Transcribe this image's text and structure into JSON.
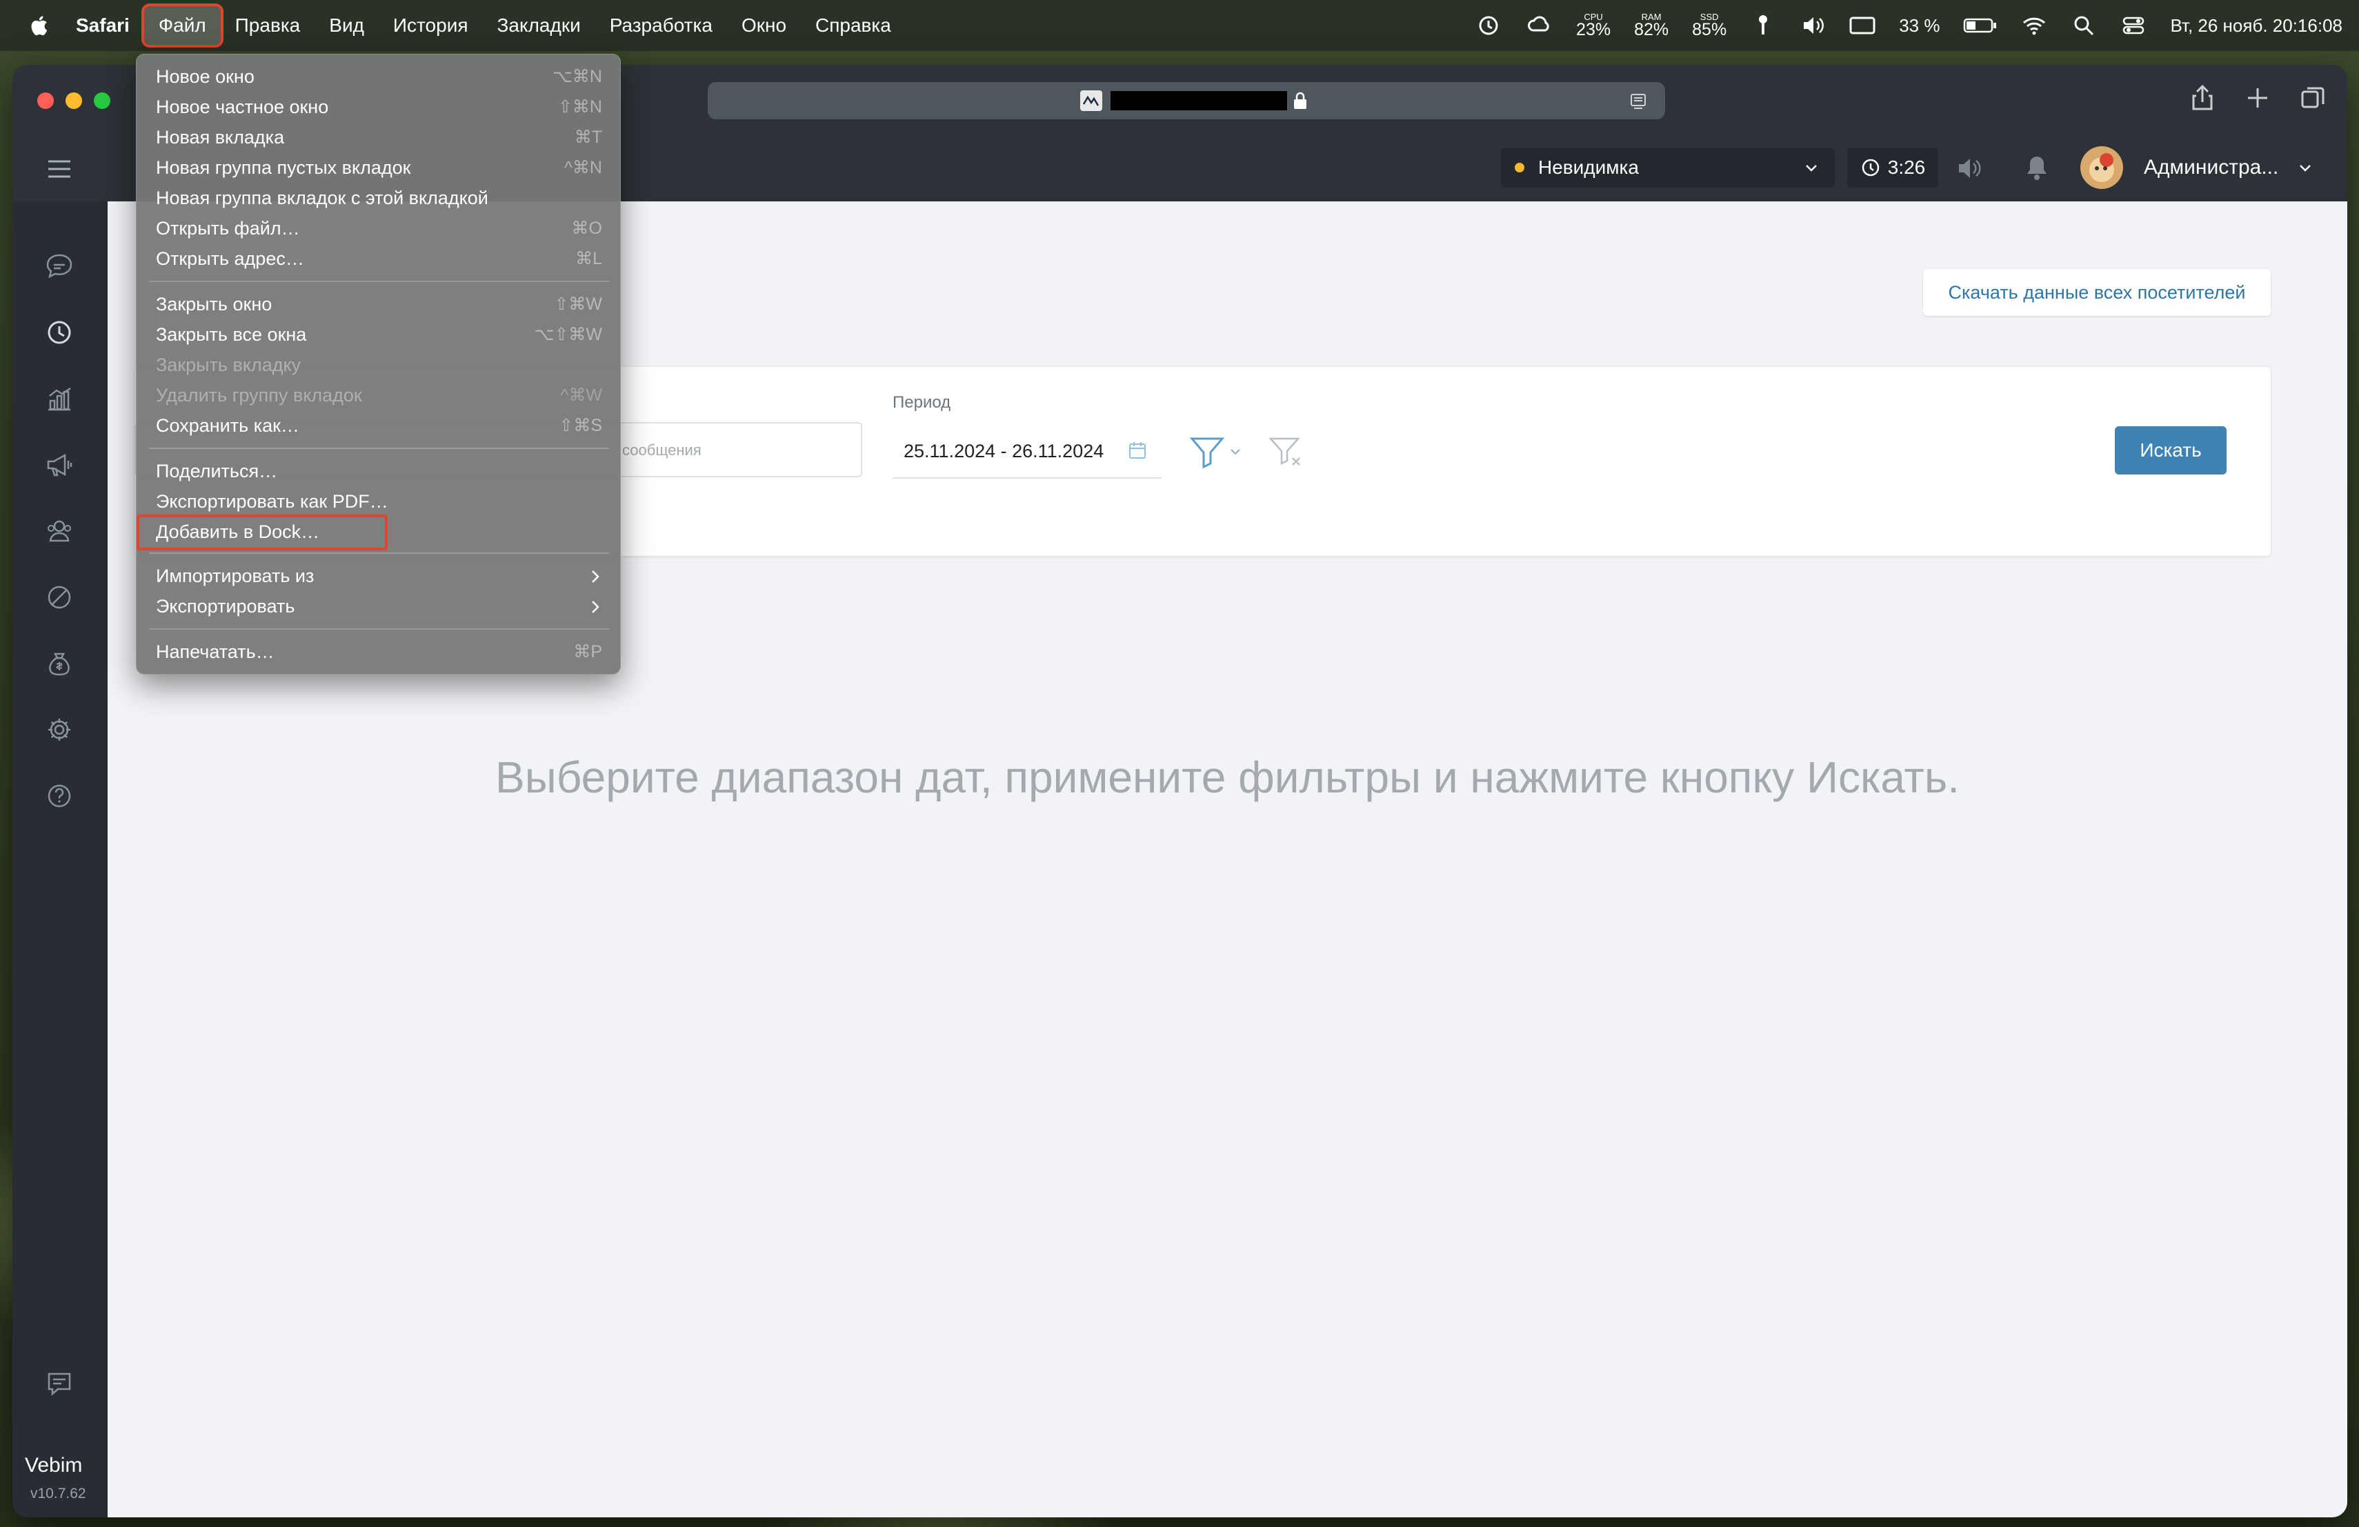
{
  "menubar": {
    "app": "Safari",
    "items": [
      "Файл",
      "Правка",
      "Вид",
      "История",
      "Закладки",
      "Разработка",
      "Окно",
      "Справка"
    ],
    "cpu": {
      "label": "CPU",
      "value": "23%"
    },
    "ram": {
      "label": "RAM",
      "value": "82%"
    },
    "ssd": {
      "label": "SSD",
      "value": "85%"
    },
    "battery": "33 %",
    "datetime": "Вт, 26 нояб.  20:16:08"
  },
  "file_menu": {
    "items": [
      {
        "label": "Новое окно",
        "shortcut": "⌥⌘N"
      },
      {
        "label": "Новое частное окно",
        "shortcut": "⇧⌘N"
      },
      {
        "label": "Новая вкладка",
        "shortcut": "⌘T"
      },
      {
        "label": "Новая группа пустых вкладок",
        "shortcut": "^⌘N"
      },
      {
        "label": "Новая группа вкладок с этой вкладкой",
        "shortcut": ""
      },
      {
        "label": "Открыть файл…",
        "shortcut": "⌘O"
      },
      {
        "label": "Открыть адрес…",
        "shortcut": "⌘L"
      },
      {
        "label": "Закрыть окно",
        "shortcut": "⇧⌘W"
      },
      {
        "label": "Закрыть все окна",
        "shortcut": "⌥⇧⌘W"
      },
      {
        "label": "Закрыть вкладку",
        "shortcut": ""
      },
      {
        "label": "Удалить группу вкладок",
        "shortcut": "^⌘W"
      },
      {
        "label": "Сохранить как…",
        "shortcut": "⇧⌘S"
      },
      {
        "label": "Поделиться…",
        "shortcut": ""
      },
      {
        "label": "Экспортировать как PDF…",
        "shortcut": ""
      },
      {
        "label": "Добавить в Dock…",
        "shortcut": ""
      },
      {
        "label": "Импортировать из",
        "shortcut": ""
      },
      {
        "label": "Экспортировать",
        "shortcut": ""
      },
      {
        "label": "Напечатать…",
        "shortcut": "⌘P"
      }
    ]
  },
  "app": {
    "status": "Невидимка",
    "timer": "3:26",
    "user": "Администра...",
    "logo": "Vebim",
    "version": "v10.7.62"
  },
  "page": {
    "download_button": "Скачать данные всех посетителей",
    "message_placeholder": "сообщения",
    "period_label": "Период",
    "period_value": "25.11.2024 - 26.11.2024",
    "search_button": "Искать",
    "hint": "Выберите диапазон дат, примените фильтры и нажмите кнопку Искать."
  }
}
